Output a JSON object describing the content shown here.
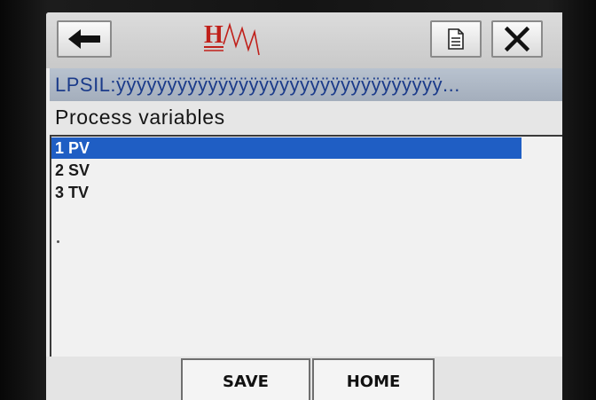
{
  "header": {
    "back_icon": "arrow-left-icon",
    "logo_letter": "H",
    "logo_icon": "hart-wave-logo",
    "doc_icon": "document-icon",
    "close_icon": "close-x-icon",
    "logo_color": "#c0201a"
  },
  "device_tag": "LPSIL:ÿÿÿÿÿÿÿÿÿÿÿÿÿÿÿÿÿÿÿÿÿÿÿÿÿÿÿÿÿÿÿÿ...",
  "menu_title": "Process variables",
  "menu": {
    "items": [
      {
        "label": "1 PV",
        "selected": true
      },
      {
        "label": "2 SV",
        "selected": false
      },
      {
        "label": "3 TV",
        "selected": false
      }
    ],
    "selection_color": "#1f5ec4"
  },
  "softkeys": {
    "save_label": "SAVE",
    "home_label": "HOME"
  }
}
